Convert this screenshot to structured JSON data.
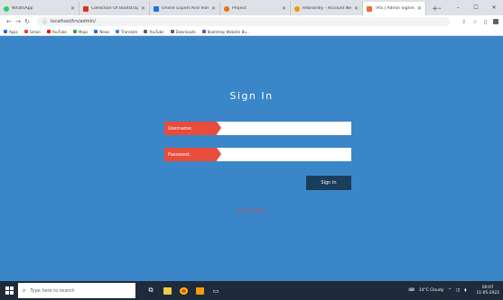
{
  "browser": {
    "tabs": [
      {
        "label": "WhatsApp",
        "icon": "whatsapp-icon",
        "color": "#e74c3c"
      },
      {
        "label": "Collection Of Bootstrap Online...",
        "icon": "site-icon",
        "color": "#d93025"
      },
      {
        "label": "Online Expert And Video Cloud...",
        "icon": "site-icon",
        "color": "#1a73e8"
      },
      {
        "label": "Project",
        "icon": "project-icon",
        "color": "#e8710a"
      },
      {
        "label": "Rebrandly - Account Network...",
        "icon": "rebrandly-icon",
        "color": "#f29900"
      },
      {
        "label": "TRS | Admin Signin",
        "icon": "site-icon",
        "color": "#f06c2d",
        "active": true
      }
    ],
    "new_tab": "+",
    "window_controls": [
      "⌄",
      "–",
      "☐",
      "✕"
    ],
    "nav": {
      "back": "←",
      "forward": "→",
      "reload": "↻"
    },
    "url": "localhost/trs/admin/",
    "url_icon": "info-icon",
    "addr_icons": [
      "share-icon",
      "star-icon",
      "sidebar-icon",
      "profile-icon"
    ],
    "bookmarks": [
      {
        "label": "Apps",
        "color": "#1a73e8"
      },
      {
        "label": "Gmail",
        "color": "#ea4335"
      },
      {
        "label": "YouTube",
        "color": "#ff0000"
      },
      {
        "label": "Maps",
        "color": "#34a853"
      },
      {
        "label": "News",
        "color": "#1a73e8"
      },
      {
        "label": "Translate",
        "color": "#4285f4"
      },
      {
        "label": "YouTube",
        "color": "#5f6368"
      },
      {
        "label": "Downloads",
        "color": "#5f6368"
      },
      {
        "label": "Bootstrap Website Bu...",
        "color": "#7952b3"
      }
    ]
  },
  "signin": {
    "title": "Sign In",
    "username_label": "Username:",
    "username_value": "",
    "password_label": "Password:",
    "password_value": "",
    "button_label": "Sign In",
    "error_text": "Invalid details"
  },
  "taskbar": {
    "search_placeholder": "Type here to search",
    "weather": "14°C  Cloudy",
    "time": "00:07",
    "date": "11-05-2022"
  },
  "colors": {
    "page_bg": "#3a86c8",
    "label_bg": "#e74c3c",
    "button_bg": "#1a3d5c"
  }
}
